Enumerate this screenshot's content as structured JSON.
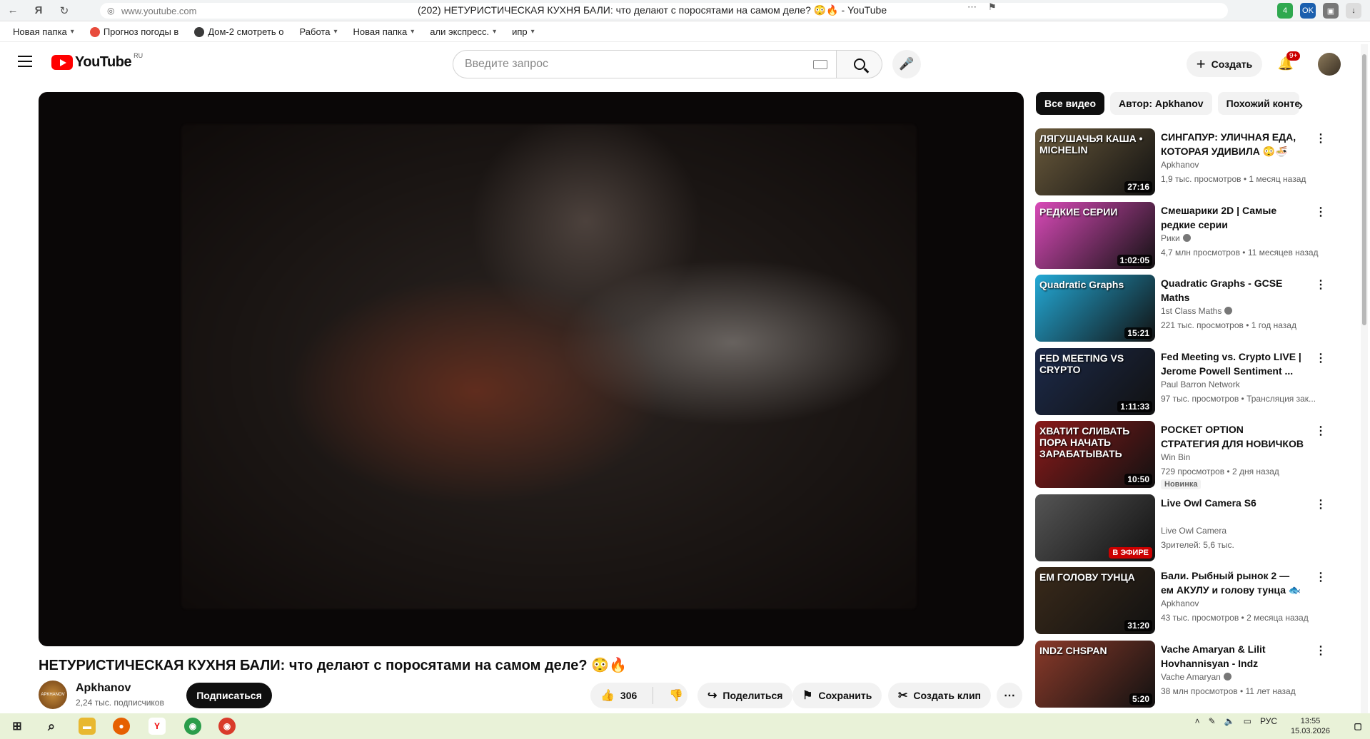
{
  "browser": {
    "url": "www.youtube.com",
    "tab_title": "(202) НЕТУРИСТИЧЕСКАЯ КУХНЯ БАЛИ: что делают с поросятами на самом деле? 😳🔥 - YouTube",
    "extension_badge": "4"
  },
  "bookmarks": [
    {
      "label": "Новая папка",
      "chevron": true
    },
    {
      "label": "Прогноз погоды в",
      "chevron": false
    },
    {
      "label": "Дом-2 смотреть о",
      "chevron": false
    },
    {
      "label": "Работа",
      "chevron": true
    },
    {
      "label": "Новая папка",
      "chevron": true
    },
    {
      "label": "али экспресс.",
      "chevron": true
    },
    {
      "label": "ипр",
      "chevron": true
    }
  ],
  "header": {
    "logo_text": "YouTube",
    "logo_region": "RU",
    "search_placeholder": "Введите запрос",
    "create_label": "Создать",
    "notifications_badge": "9+"
  },
  "video": {
    "title": "НЕТУРИСТИЧЕСКАЯ КУХНЯ БАЛИ: что делают с поросятами на самом деле? 😳🔥",
    "channel": "Apkhanov",
    "avatar_text": "APKHANOV",
    "subscribers": "2,24 тыс. подписчиков",
    "subscribe_label": "Подписаться",
    "likes": "306",
    "share_label": "Поделиться",
    "save_label": "Сохранить",
    "clip_label": "Создать клип"
  },
  "chips": [
    "Все видео",
    "Автор: Apkhanov",
    "Похожий конте"
  ],
  "recommendations": [
    {
      "title": "СИНГАПУР: УЛИЧНАЯ ЕДА, КОТОРАЯ УДИВИЛА 😳🍜",
      "channel": "Apkhanov",
      "verified": false,
      "meta": "1,9 тыс. просмотров • 1 месяц назад",
      "duration": "27:16",
      "thumb_text": "ЛЯГУШАЧЬЯ КАША • MICHELIN",
      "thumb_color": "#6a5a3c"
    },
    {
      "title": "Смешарики 2D | Самые редкие серии",
      "channel": "Рики",
      "verified": true,
      "meta": "4,7 млн просмотров • 11 месяцев назад",
      "duration": "1:02:05",
      "thumb_text": "РЕДКИЕ СЕРИИ",
      "thumb_color": "#d94ab8"
    },
    {
      "title": "Quadratic Graphs - GCSE Maths",
      "channel": "1st Class Maths",
      "verified": true,
      "meta": "221 тыс. просмотров • 1 год назад",
      "duration": "15:21",
      "thumb_text": "Quadratic Graphs",
      "thumb_color": "#23a9d6"
    },
    {
      "title": "Fed Meeting vs. Crypto LIVE | Jerome Powell Sentiment ...",
      "channel": "Paul Barron Network",
      "verified": false,
      "meta": "97 тыс. просмотров • Трансляция зак...",
      "duration": "1:11:33",
      "thumb_text": "FED MEETING VS CRYPTO",
      "thumb_color": "#1c2a4a"
    },
    {
      "title": "POCKET OPTION СТРАТЕГИЯ ДЛЯ НОВИЧКОВ ПОКЕТ ...",
      "channel": "Win Bin",
      "verified": false,
      "meta": "729 просмотров • 2 дня назад",
      "duration": "10:50",
      "badge": "Новинка",
      "thumb_text": "ХВАТИТ СЛИВАТЬ ПОРА НАЧАТЬ ЗАРАБАТЫВАТЬ",
      "thumb_color": "#8a1a1a"
    },
    {
      "title": "Live Owl Camera S6",
      "channel": "Live Owl Camera",
      "verified": false,
      "meta": "Зрителей: 5,6 тыс.",
      "live": "В ЭФИРЕ",
      "thumb_text": "",
      "thumb_color": "#555555"
    },
    {
      "title": "Бали. Рыбный рынок 2 — ем АКУЛУ и голову тунца 🐟🔥",
      "channel": "Apkhanov",
      "verified": false,
      "meta": "43 тыс. просмотров • 2 месяца назад",
      "duration": "31:20",
      "thumb_text": "ЕМ ГОЛОВУ ТУНЦА",
      "thumb_color": "#3a2a1a"
    },
    {
      "title": "Vache Amaryan & Lilit Hovhannisyan - Indz Chspane...",
      "channel": "Vache Amaryan",
      "verified": true,
      "meta": "38 млн просмотров • 11 лет назад",
      "duration": "5:20",
      "thumb_text": "INDZ CHSPAN",
      "thumb_color": "#8a3a2a"
    }
  ],
  "taskbar": {
    "language": "РУС",
    "time": "13:55",
    "date": "15.03.2026"
  }
}
